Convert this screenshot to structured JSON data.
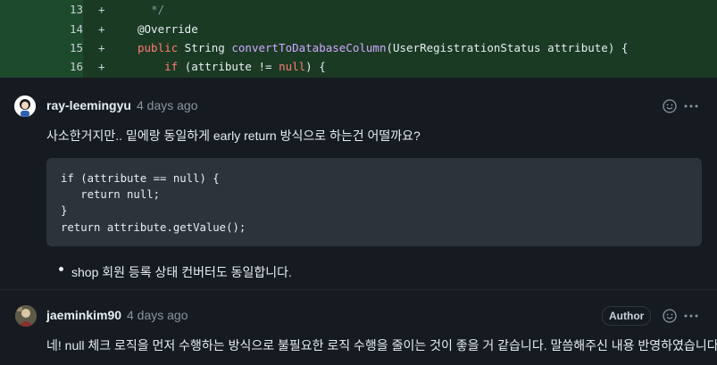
{
  "diff": {
    "lines": [
      {
        "number": "13",
        "marker": "+",
        "indent": "  ",
        "text": "*/"
      },
      {
        "number": "14",
        "marker": "+",
        "text": "@Override"
      },
      {
        "number": "15",
        "marker": "+",
        "kw": "public",
        "rest": " String ",
        "fn": "convertToDatabaseColumn",
        "rest2": "(UserRegistrationStatus attribute) {"
      },
      {
        "number": "16",
        "marker": "+",
        "indent": "    ",
        "kw": "if",
        "rest": " (attribute != ",
        "kw2": "null",
        "rest2": ") {"
      }
    ]
  },
  "comments": [
    {
      "author": "ray-leemingyu",
      "time": "4 days ago",
      "text": "사소한거지만.. 밑에랑 동일하게 early return 방식으로 하는건 어떨까요?",
      "code": "if (attribute == null) {\n   return null;\n}\nreturn attribute.getValue();",
      "bullet": "shop 회원 등록 상태 컨버터도 동일합니다."
    },
    {
      "author": "jaeminkim90",
      "time": "4 days ago",
      "badge": "Author",
      "text": "네! null 체크 로직을 먼저 수행하는 방식으로 불필요한 로직 수행을 줄이는 것이 좋을 거 같습니다. 말씀해주신 내용 반영하였습니다."
    }
  ],
  "icons": {
    "reaction": "smiley-icon",
    "more": "kebab-icon"
  }
}
